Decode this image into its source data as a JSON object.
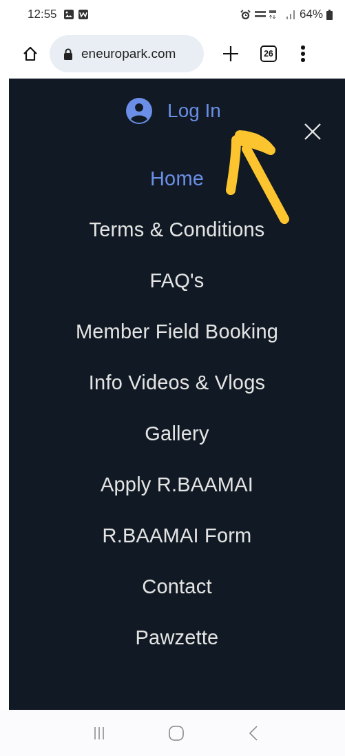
{
  "status_bar": {
    "time": "12:55",
    "battery": "64%"
  },
  "browser": {
    "url": "eneuropark.com",
    "tab_count": "26"
  },
  "menu": {
    "login": "Log In",
    "items": [
      {
        "label": "Home",
        "selected": true
      },
      {
        "label": "Terms & Conditions",
        "selected": false
      },
      {
        "label": "FAQ's",
        "selected": false
      },
      {
        "label": "Member Field Booking",
        "selected": false
      },
      {
        "label": "Info Videos & Vlogs",
        "selected": false
      },
      {
        "label": "Gallery",
        "selected": false
      },
      {
        "label": "Apply R.BAAMAI",
        "selected": false
      },
      {
        "label": "R.BAAMAI Form",
        "selected": false
      },
      {
        "label": "Contact",
        "selected": false
      },
      {
        "label": "Pawzette",
        "selected": false
      }
    ]
  }
}
